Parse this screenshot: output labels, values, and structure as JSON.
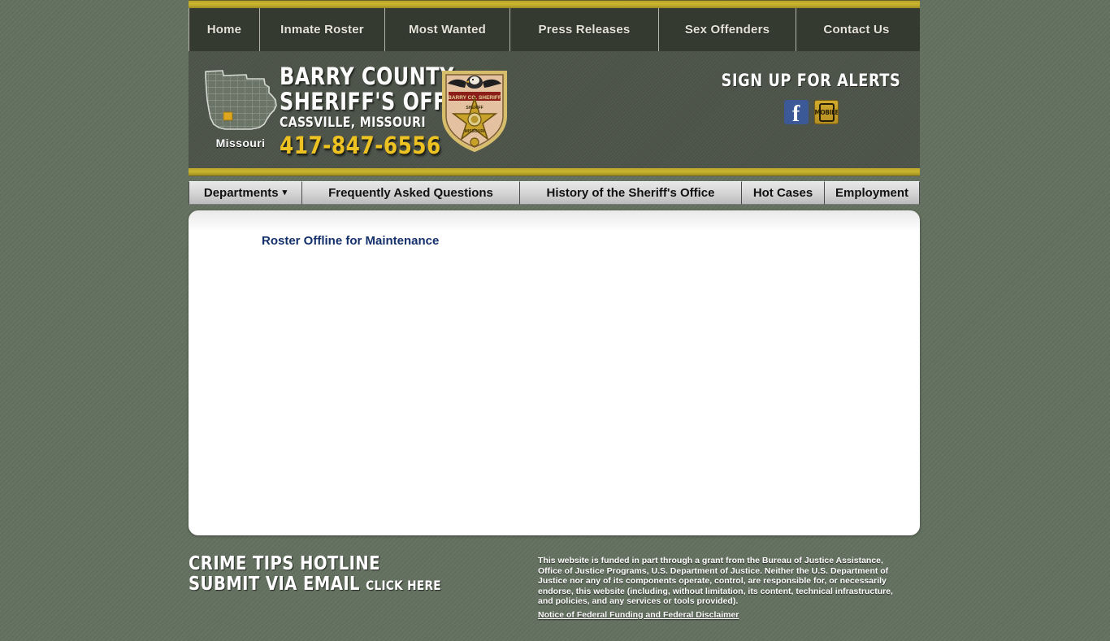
{
  "topnav": {
    "items": [
      {
        "label": "Home",
        "name": "nav-home",
        "cls": "nav-w-home"
      },
      {
        "label": "Inmate Roster",
        "name": "nav-inmate-roster",
        "cls": "nav-w-roster"
      },
      {
        "label": "Most Wanted",
        "name": "nav-most-wanted",
        "cls": "nav-w-wanted"
      },
      {
        "label": "Press Releases",
        "name": "nav-press-releases",
        "cls": "nav-w-press"
      },
      {
        "label": "Sex Offenders",
        "name": "nav-sex-offenders",
        "cls": "nav-w-sex"
      },
      {
        "label": "Contact Us",
        "name": "nav-contact-us",
        "cls": "nav-w-contact"
      }
    ]
  },
  "header": {
    "map_label": "Missouri",
    "title_line1": "BARRY COUNTY",
    "title_line2": "SHERIFF'S OFFICE",
    "location": "CASSVILLE, MISSOURI",
    "phone": "417-847-6556",
    "badge_alt": "sheriff-badge",
    "alerts_title": "SIGN UP FOR ALERTS",
    "facebook_label": "f",
    "mobile_label": "MOBILE"
  },
  "subnav": {
    "items": [
      {
        "label": "Departments",
        "name": "subnav-departments",
        "cls": "sub-w-dept",
        "caret": "▾"
      },
      {
        "label": "Frequently Asked Questions",
        "name": "subnav-faq",
        "cls": "sub-w-faq",
        "caret": ""
      },
      {
        "label": "History of the Sheriff's Office",
        "name": "subnav-history",
        "cls": "sub-w-history",
        "caret": ""
      },
      {
        "label": "Hot Cases",
        "name": "subnav-hot-cases",
        "cls": "sub-w-hot",
        "caret": ""
      },
      {
        "label": "Employment",
        "name": "subnav-employment",
        "cls": "sub-w-emp",
        "caret": ""
      }
    ]
  },
  "main": {
    "roster_message": "Roster Offline for Maintenance"
  },
  "footer": {
    "tips_line1": "CRIME TIPS HOTLINE",
    "tips_line2": "SUBMIT VIA EMAIL",
    "tips_click": "CLICK HERE",
    "disclaimer": "This website is funded in part through a grant from the Bureau of Justice Assistance, Office of Justice Programs, U.S. Department of Justice. Neither the U.S. Department of Justice nor any of its components operate, control, are responsible for, or necessarily endorse, this website (including, without limitation, its content, technical infrastructure, and policies, and any services or tools provided).",
    "disclaimer_link": "Notice of Federal Funding and Federal Disclaimer"
  },
  "colors": {
    "page_background": "#63705f",
    "gold_bar": "#cbb52f",
    "topnav_background": "#343a30",
    "header_background": "#4d5449",
    "phone_gold": "#f0c420",
    "roster_message": "#14306b",
    "facebook_blue": "#3b5998"
  }
}
